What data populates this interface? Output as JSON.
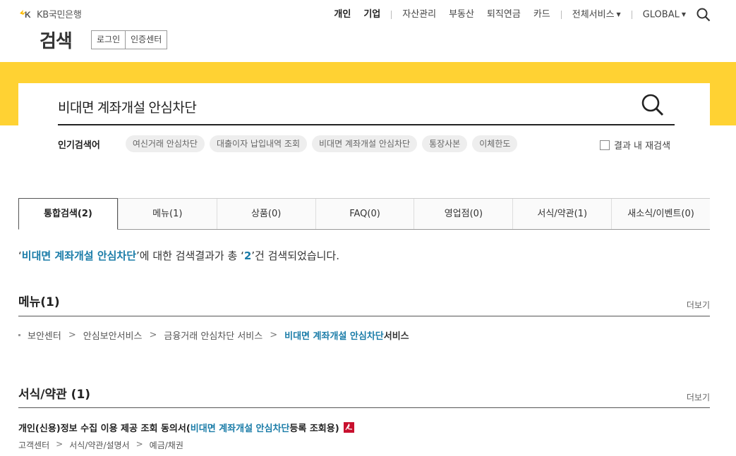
{
  "header": {
    "logo_text": "KB국민은행",
    "page_title": "검색",
    "util": {
      "login": "로그인",
      "cert": "인증센터"
    },
    "gnb": {
      "personal": "개인",
      "business": "기업",
      "asset": "자산관리",
      "realestate": "부동산",
      "pension": "퇴직연금",
      "card": "카드",
      "all_services": "전체서비스",
      "global": "GLOBAL"
    }
  },
  "search": {
    "query": "비대면 계좌개설 안심차단",
    "popular_label": "인기검색어",
    "popular_tags": [
      "여신거래 안심차단",
      "대출이자 납입내역 조회",
      "비대면 계좌개설 안심차단",
      "통장사본",
      "이체한도"
    ],
    "research_label": "결과 내 재검색"
  },
  "tabs": [
    {
      "label": "통합검색(2)",
      "active": true
    },
    {
      "label": "메뉴(1)"
    },
    {
      "label": "상품(0)"
    },
    {
      "label": "FAQ(0)"
    },
    {
      "label": "영업점(0)"
    },
    {
      "label": "서식/약관(1)"
    },
    {
      "label": "새소식/이벤트(0)"
    }
  ],
  "summary": {
    "open_quote": "‘",
    "keyword": "비대면 계좌개설 안심차단",
    "mid": "’에 대한 검색결과가 총 ‘",
    "count": "2",
    "end": "’건 검색되었습니다."
  },
  "menu_section": {
    "title": "메뉴(1)",
    "more": "더보기",
    "crumbs": [
      "보안센터",
      "안심보안서비스",
      "금융거래 안심차단 서비스"
    ],
    "sep": ">",
    "last_hl": "비대면 계좌개설 안심차단",
    "last_tail": " 서비스"
  },
  "form_section": {
    "title": "서식/약관 (1)",
    "more": "더보기",
    "item_title_pre": "개인(신용)정보 수집 이용 제공 조회 동의서(",
    "item_title_hl": "비대면 계좌개설 안심차단",
    "item_title_post": " 등록 조회용)",
    "path": [
      "고객센터",
      "서식/약관/설명서",
      "예금/채권"
    ],
    "sep": ">"
  },
  "colors": {
    "accent_yellow": "#ffd233",
    "highlight_blue": "#1a7ca8",
    "pdf_red": "#c8102e"
  }
}
